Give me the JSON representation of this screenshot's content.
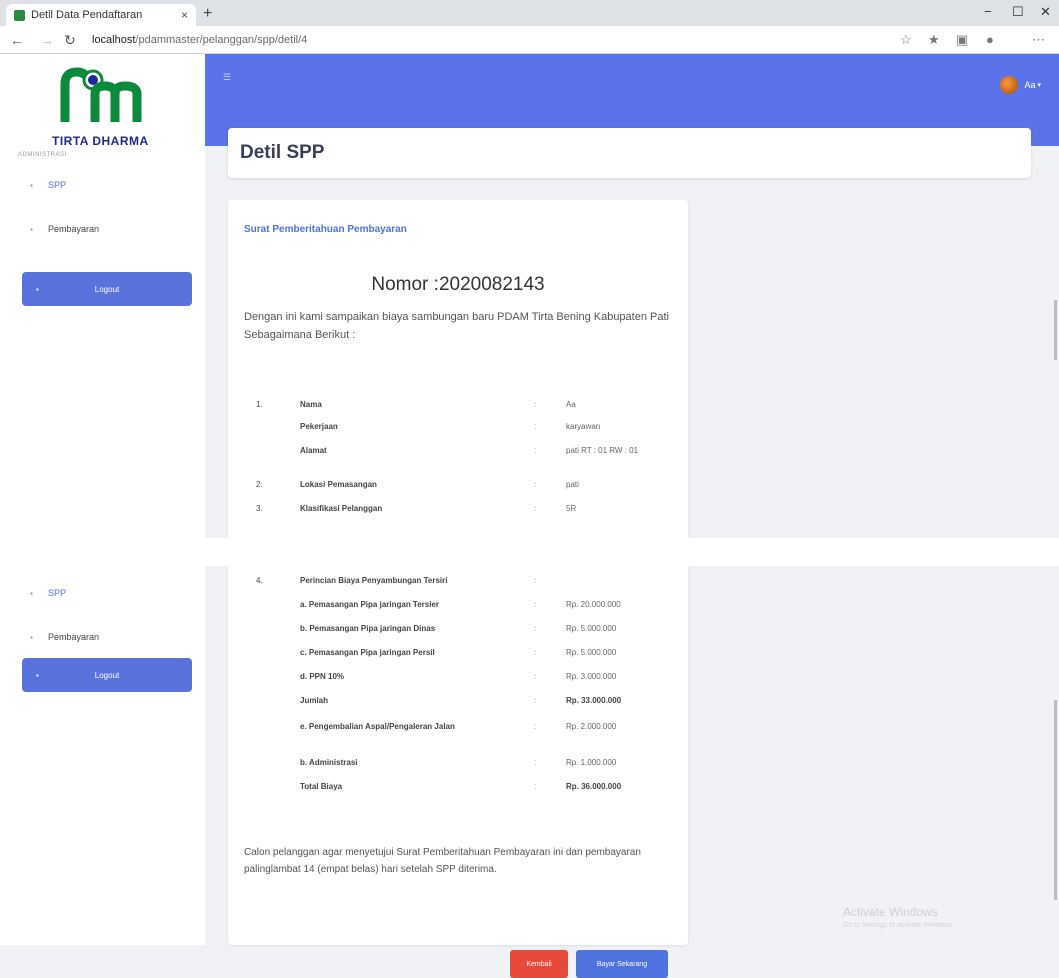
{
  "browser": {
    "tab_title": "Detil Data Pendaftaran",
    "tab_close": "×",
    "new_tab": "+",
    "minimize": "−",
    "maximize": "☐",
    "close": "✕",
    "url_host": "localhost",
    "url_path": "/pdammaster/pelanggan/spp/detil/4"
  },
  "sidebar": {
    "logo_text": "TIRTA DHARMA",
    "logo_colors": {
      "primary": "#0a8a3a",
      "dot": "#1a2a9a"
    },
    "role_label": "ADMINISTRASI",
    "items": [
      {
        "label": "SPP",
        "active": true
      },
      {
        "label": "Pembayaran",
        "active": false
      }
    ],
    "logout_label": "Logout"
  },
  "header": {
    "user_name": "Aa",
    "page_title": "Detil SPP",
    "accent_color": "#5b73e8"
  },
  "card": {
    "title": "Surat Pemberitahuan Pembayaran",
    "nomor": "Nomor :2020082143",
    "intro": "Dengan ini kami sampaikan biaya sambungan baru PDAM Tirta Bening Kabupaten Pati Sebagaimana Berikut :",
    "rows_top": [
      {
        "num": "1.",
        "label": "Nama",
        "value": "Aa"
      },
      {
        "num": "",
        "label": "Pekerjaan",
        "value": "karyawan"
      },
      {
        "num": "",
        "label": "Alamat",
        "value": "pati RT : 01 RW : 01"
      },
      {
        "num": "2.",
        "label": "Lokasi Pemasangan",
        "value": "pati"
      },
      {
        "num": "3.",
        "label": "Klasifikasi Pelanggan",
        "value": "5R"
      }
    ],
    "rows_bottom": [
      {
        "num": "4.",
        "label": "Perincian Biaya Penyambungan Tersiri",
        "value": "",
        "bold": false
      },
      {
        "num": "",
        "label": "a. Pemasangan Pipa jaringan Tersier",
        "value": "Rp. 20.000.000",
        "bold": false
      },
      {
        "num": "",
        "label": "b. Pemasangan Pipa jaringan Dinas",
        "value": "Rp. 5.000.000",
        "bold": false
      },
      {
        "num": "",
        "label": "c. Pemasangan Pipa jaringan Persil",
        "value": "Rp. 5.000.000",
        "bold": false
      },
      {
        "num": "",
        "label": "d. PPN 10%",
        "value": "Rp. 3.000.000",
        "bold": false
      },
      {
        "num": "",
        "label": "Jumlah",
        "value": "Rp. 33.000.000",
        "bold": true
      },
      {
        "num": "",
        "label": "e. Pengembalian Aspal/Pengaleran Jalan",
        "value": "Rp. 2.000.000",
        "bold": false
      },
      {
        "num": "",
        "label": "b. Administrasi",
        "value": "Rp. 1.000.000",
        "bold": false
      },
      {
        "num": "",
        "label": "Total Biaya",
        "value": "Rp. 36.000.000",
        "bold": true
      }
    ],
    "closing": "Calon pelanggan agar menyetujui Surat Pemberitahuan Pembayaran ini dan pembayaran palinglambat 14 (empat belas) hari setelah SPP diterima.",
    "btn_back": "Kembali",
    "btn_pay": "Bayar Sekarang",
    "btn_back_color": "#e74a3b",
    "btn_pay_color": "#4e73df"
  },
  "watermark": {
    "line1": "Activate Windows",
    "line2": "Go to Settings to activate Windows."
  }
}
